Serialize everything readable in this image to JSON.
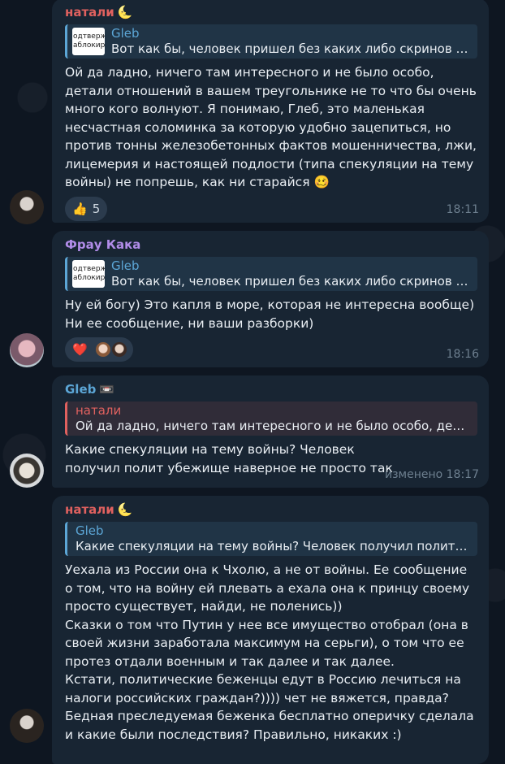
{
  "messages": [
    {
      "sender": "натали",
      "sender_emoji": "🌜",
      "sender_color": "#e0615f",
      "reply": {
        "name": "Gleb",
        "snippet": "Вот как бы, человек пришел без каких либо скринов и ...",
        "thumb_lines": [
          "одтверж",
          "аблокир"
        ]
      },
      "text": "Ой да ладно, ничего там интересного и не было особо, детали отношений в вашем треугольнике не то что бы очень много кого волнуют. Я понимаю, Глеб, это маленькая несчастная соломинка за которую удобно зацепиться, но против тонны железобетонных фактов мошенничества, лжи, лицемерия и настоящей подлости (типа спекуляции на тему войны) не попрешь, как ни старайся 🥴",
      "reaction": {
        "emoji": "👍",
        "count": "5"
      },
      "time": "18:11"
    },
    {
      "sender": "Фрау Кака",
      "sender_color": "#b18ce8",
      "reply": {
        "name": "Gleb",
        "snippet": "Вот как бы, человек пришел без каких либо скринов и ...",
        "thumb_lines": [
          "одтверж",
          "аблокир"
        ]
      },
      "text": "Ну ей богу) Это капля в море, которая не интересна вообще) Ни ее сообщение, ни ваши разборки)",
      "reaction": {
        "emoji": "❤️"
      },
      "time": "18:16"
    },
    {
      "sender": "Gleb",
      "sender_emoji": "📼",
      "sender_color": "#5ca6d6",
      "reply": {
        "name": "натали",
        "snippet": "Ой да ладно, ничего там интересного и не было особо, дета..."
      },
      "text": "Какие спекуляции на тему войны? Человек получил полит убежище наверное не просто так",
      "time": "изменено 18:17"
    },
    {
      "sender": "натали",
      "sender_emoji": "🌜",
      "sender_color": "#e0615f",
      "reply": {
        "name": "Gleb",
        "snippet": "Какие спекуляции на тему войны? Человек получил полит у..."
      },
      "text": "Уехала из России она к Чхолю, а не от войны. Ее сообщение о том, что на войну ей плевать а ехала она к принцу своему просто существует, найди, не поленись))\nСказки о том что Путин у нее все имущество отобрал (она в своей жизни заработала максимум на серьги), о том что ее протез отдали военным и так далее и так далее.\nКстати, политические беженцы едут в Россию лечиться на налоги российских граждан?)))) чет не вяжется, правда? Бедная преследуемая беженка бесплатно оперичку сделала и какие были последствия? Правильно, никаких :)"
    }
  ]
}
